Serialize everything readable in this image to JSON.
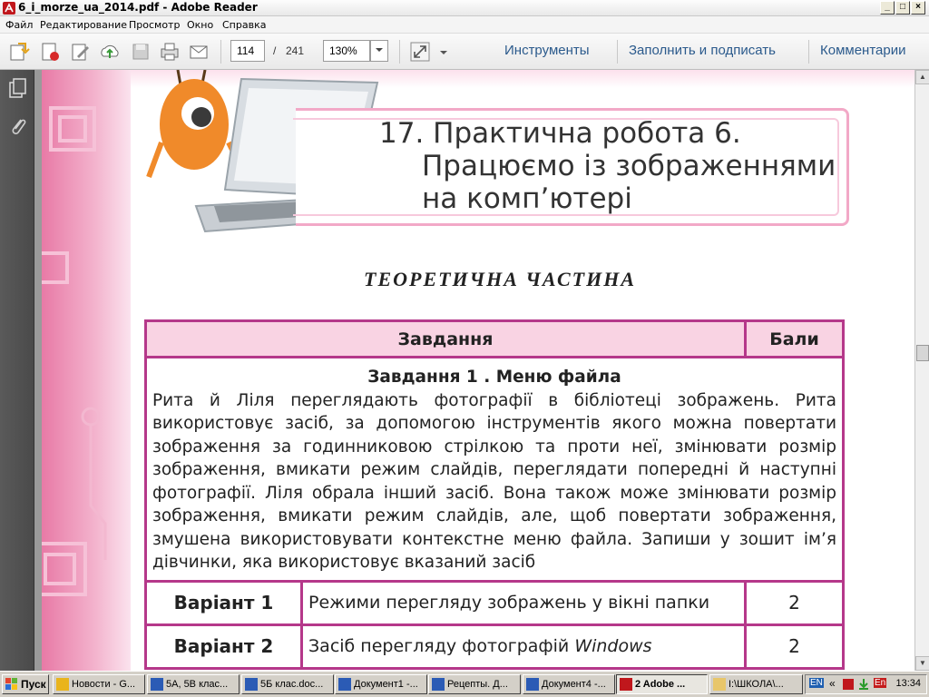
{
  "window": {
    "title": "6_i_morze_ua_2014.pdf - Adobe Reader",
    "controls": [
      "_",
      "□",
      "×"
    ]
  },
  "menu": {
    "items": [
      "Файл",
      "Редактирование",
      "Просмотр",
      "Окно",
      "Справка"
    ]
  },
  "toolbar": {
    "current_page": "114",
    "page_separator": "/",
    "total_pages": "241",
    "zoom": "130%",
    "tools_label": "Инструменты",
    "fill_sign_label": "Заполнить и подписать",
    "comments_label": "Комментарии"
  },
  "document": {
    "heading_line1": "17. Практична робота 6.",
    "heading_line2": "Працюємо із зображеннями",
    "heading_line3": "на комп’ютері",
    "section_title": "ТЕОРЕТИЧНА ЧАСТИНА",
    "table": {
      "col_task": "Завдання",
      "col_score": "Бали",
      "task1_title": "Завдання 1 . Меню файла",
      "task1_text": "Рита й Ліля переглядають фотографії в бібліотеці зображень. Рита використовує засіб, за допомогою інструментів якого можна повертати зображення за годинниковою стрілкою та проти неї, змінювати розмір зображення, вмикати режим слайдів, переглядати попередні й наступні фотографії. Ліля обрала інший засіб. Вона також може змінювати розмір зображення, вмикати режим слайдів, але, щоб повертати зображення, змушена використовувати контекстне меню файла. Запиши у зошит ім’я дівчинки, яка використовує вказаний засіб",
      "variants": [
        {
          "label": "Варіант 1",
          "text": "Режими перегляду зображень у вікні папки",
          "score": "2"
        },
        {
          "label": "Варіант 2",
          "text_plain": "Засіб перегляду фотографій ",
          "text_italic": "Windows",
          "score": "2"
        }
      ]
    }
  },
  "taskbar": {
    "start_label": "Пуск",
    "tasks": [
      {
        "label": "Новости - G...",
        "icon": "chrome-icon"
      },
      {
        "label": "5А, 5В клас...",
        "icon": "word-icon"
      },
      {
        "label": "5Б клас.doc...",
        "icon": "word-icon"
      },
      {
        "label": "Документ1 -...",
        "icon": "word-icon"
      },
      {
        "label": "Рецепты. Д...",
        "icon": "word-icon"
      },
      {
        "label": "Документ4 -...",
        "icon": "word-icon"
      },
      {
        "label": "2 Adobe ...",
        "icon": "adobe-icon"
      },
      {
        "label": "I:\\ШКОЛА\\...",
        "icon": "folder-icon"
      }
    ],
    "lang": "EN",
    "tray_lang": "En",
    "clock": "13:34"
  },
  "colors": {
    "table_border": "#b5388a",
    "header_fill": "#f9d3e3",
    "link_blue": "#2b5a8c"
  }
}
